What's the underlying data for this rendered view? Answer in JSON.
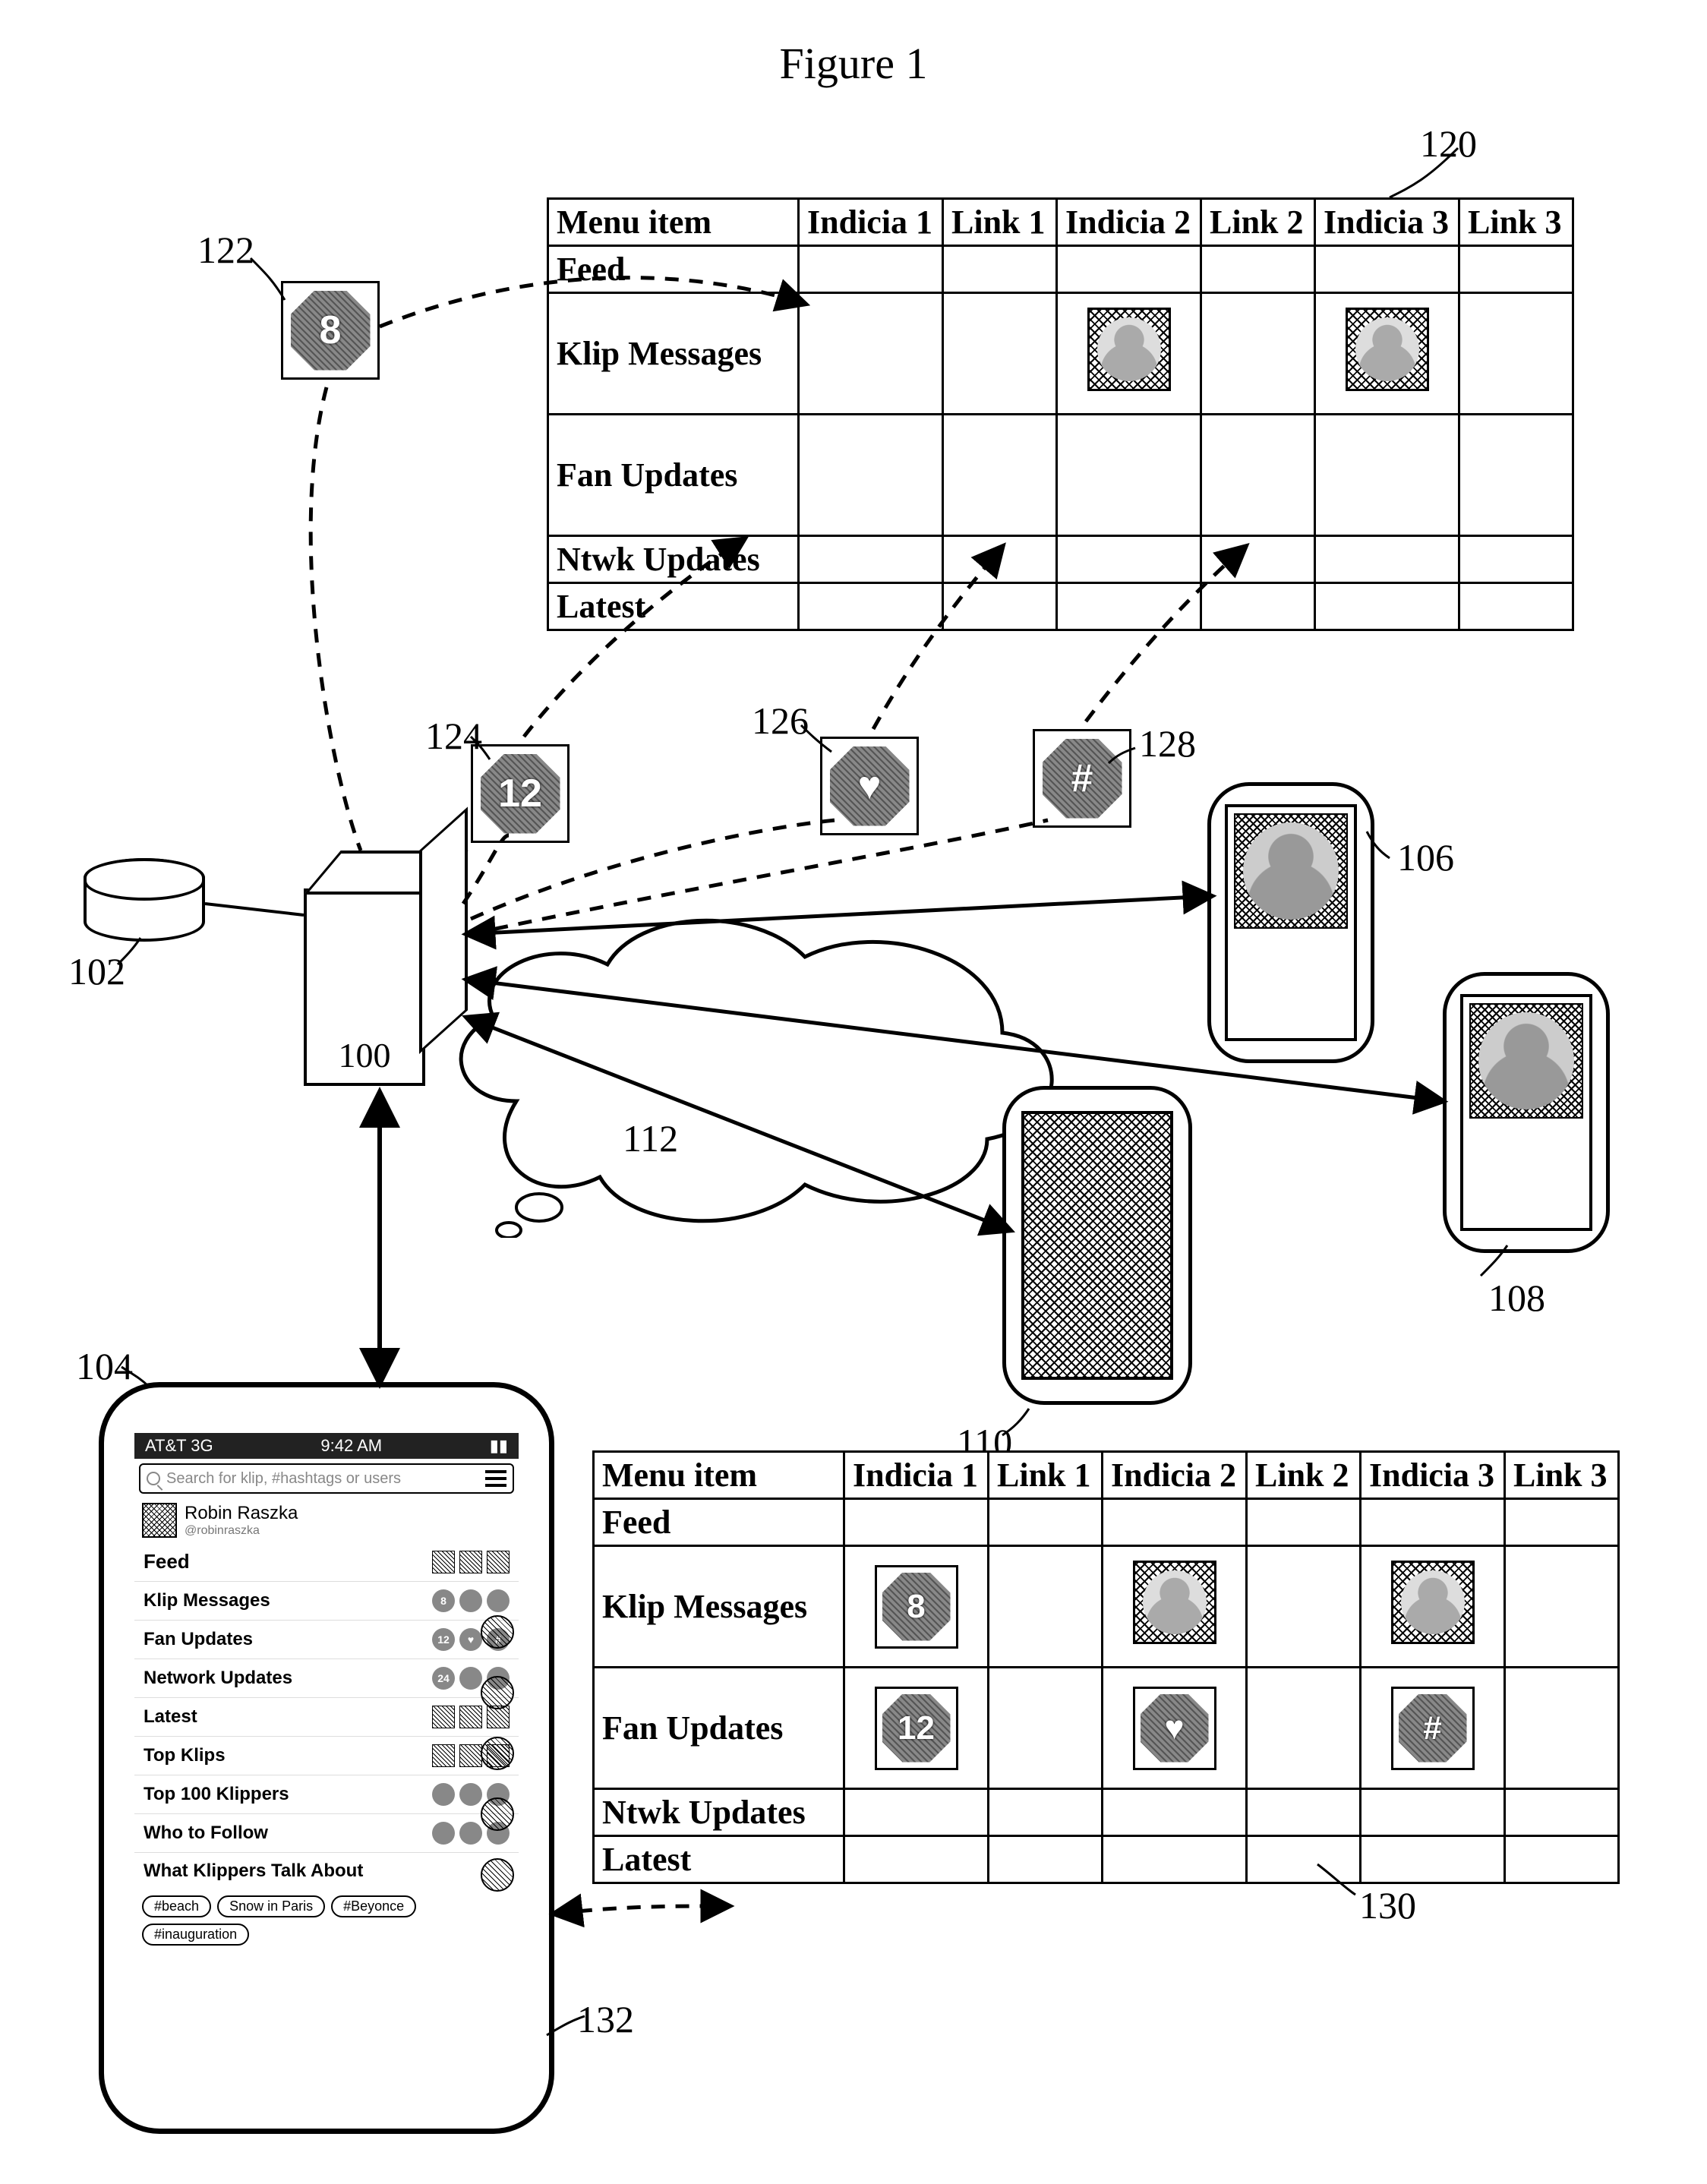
{
  "figure_title": "Figure 1",
  "refs": {
    "r100": "100",
    "r102": "102",
    "r104": "104",
    "r106": "106",
    "r108": "108",
    "r110": "110",
    "r112": "112",
    "r120": "120",
    "r122": "122",
    "r124": "124",
    "r126": "126",
    "r128": "128",
    "r130": "130",
    "r132": "132"
  },
  "table_headers": {
    "c0": "Menu item",
    "c1": "Indicia 1",
    "c2": "Link 1",
    "c3": "Indicia 2",
    "c4": "Link 2",
    "c5": "Indicia 3",
    "c6": "Link 3"
  },
  "menu_rows": {
    "feed": "Feed",
    "klip": "Klip Messages",
    "fan": "Fan Updates",
    "ntwk": "Ntwk Updates",
    "latest": "Latest"
  },
  "badges": {
    "b8": "8",
    "b12": "12",
    "heart": "♥",
    "hash": "#"
  },
  "phone_app": {
    "status_left": "AT&T  3G",
    "status_time": "9:42 AM",
    "search_placeholder": "Search for klip, #hashtags or users",
    "user_name": "Robin Raszka",
    "user_handle": "@robinraszka",
    "menu": {
      "feed": "Feed",
      "klip_messages": "Klip Messages",
      "fan_updates": "Fan Updates",
      "network_updates": "Network Updates",
      "latest": "Latest",
      "top_klips": "Top Klips",
      "top_100": "Top 100 Klippers",
      "who_follow": "Who to Follow",
      "talk_about": "What Klippers Talk About"
    },
    "counts": {
      "klip_messages": "8",
      "fan_updates": "12",
      "network_updates": "24"
    },
    "chips": {
      "c1": "#beach",
      "c2": "Snow in Paris",
      "c3": "#Beyonce",
      "c4": "#inauguration"
    }
  }
}
